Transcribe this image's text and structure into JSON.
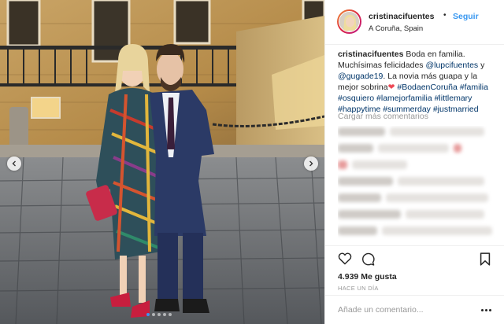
{
  "header": {
    "username": "cristinacifuentes",
    "separator": "•",
    "follow_label": "Seguir",
    "location": "A Coruña, Spain"
  },
  "caption": {
    "username": "cristinacifuentes",
    "text_1": " Boda en familia. Muchísimas felicidades ",
    "mention_1": "@lupcifuentes",
    "text_2": " y ",
    "mention_2": "@gugade19",
    "text_3": ". La novia más guapa y la mejor sobrina",
    "heart": "❤",
    "hashtags": [
      "#BodaenCoruña",
      "#familia",
      "#osquiero",
      "#lamejorfamilia",
      "#littlemary",
      "#happytime",
      "#summerday",
      "#justmarried"
    ]
  },
  "comments": {
    "load_more_label": "Cargar más comentarios"
  },
  "actions": {
    "likes": "4.939 Me gusta",
    "time_ago": "HACE UN DÍA"
  },
  "add_comment": {
    "placeholder": "Añade un comentario..."
  },
  "carousel": {
    "slide_count": 5,
    "active_slide": 1
  },
  "icons": {
    "prev": "chevron-left-icon",
    "next": "chevron-right-icon",
    "like": "heart-icon",
    "comment": "comment-bubble-icon",
    "save": "bookmark-icon",
    "more": "ellipsis-icon"
  },
  "colors": {
    "link": "#3897f0",
    "hashtag": "#003569",
    "heart": "#ed4956",
    "muted": "#999999",
    "text": "#262626"
  }
}
